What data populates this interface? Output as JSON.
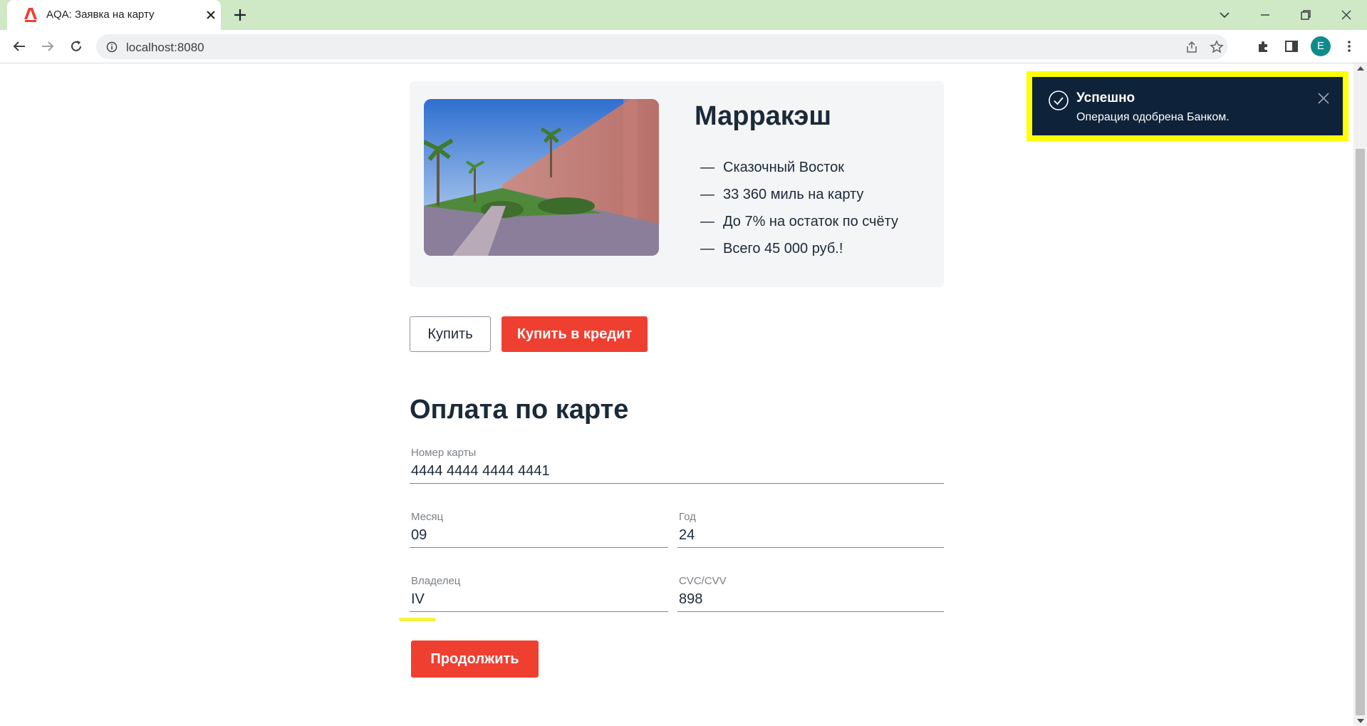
{
  "browser": {
    "tab_title": "AQA: Заявка на карту",
    "url": "localhost:8080",
    "profile_initial": "E"
  },
  "offer": {
    "title": "Марракэш",
    "features": [
      "Сказочный Восток",
      "33 360 миль на карту",
      "До 7% на остаток по счёту",
      "Всего 45 000 руб.!"
    ],
    "dash": "—"
  },
  "actions": {
    "buy_label": "Купить",
    "credit_label": "Купить в кредит"
  },
  "payment_form": {
    "title": "Оплата по карте",
    "card_number": {
      "label": "Номер карты",
      "value": "4444 4444 4444 4441"
    },
    "month": {
      "label": "Месяц",
      "value": "09"
    },
    "year": {
      "label": "Год",
      "value": "24"
    },
    "owner": {
      "label": "Владелец",
      "value": "IV"
    },
    "cvc": {
      "label": "CVC/CVV",
      "value": "898"
    },
    "continue_label": "Продолжить"
  },
  "notification": {
    "title": "Успешно",
    "text": "Операция одобрена Банком."
  },
  "colors": {
    "brand_red": "#ef3f31",
    "toast_bg": "#0e2239",
    "highlight": "#ffff00",
    "tabbar_bg": "#cfe8c5"
  }
}
